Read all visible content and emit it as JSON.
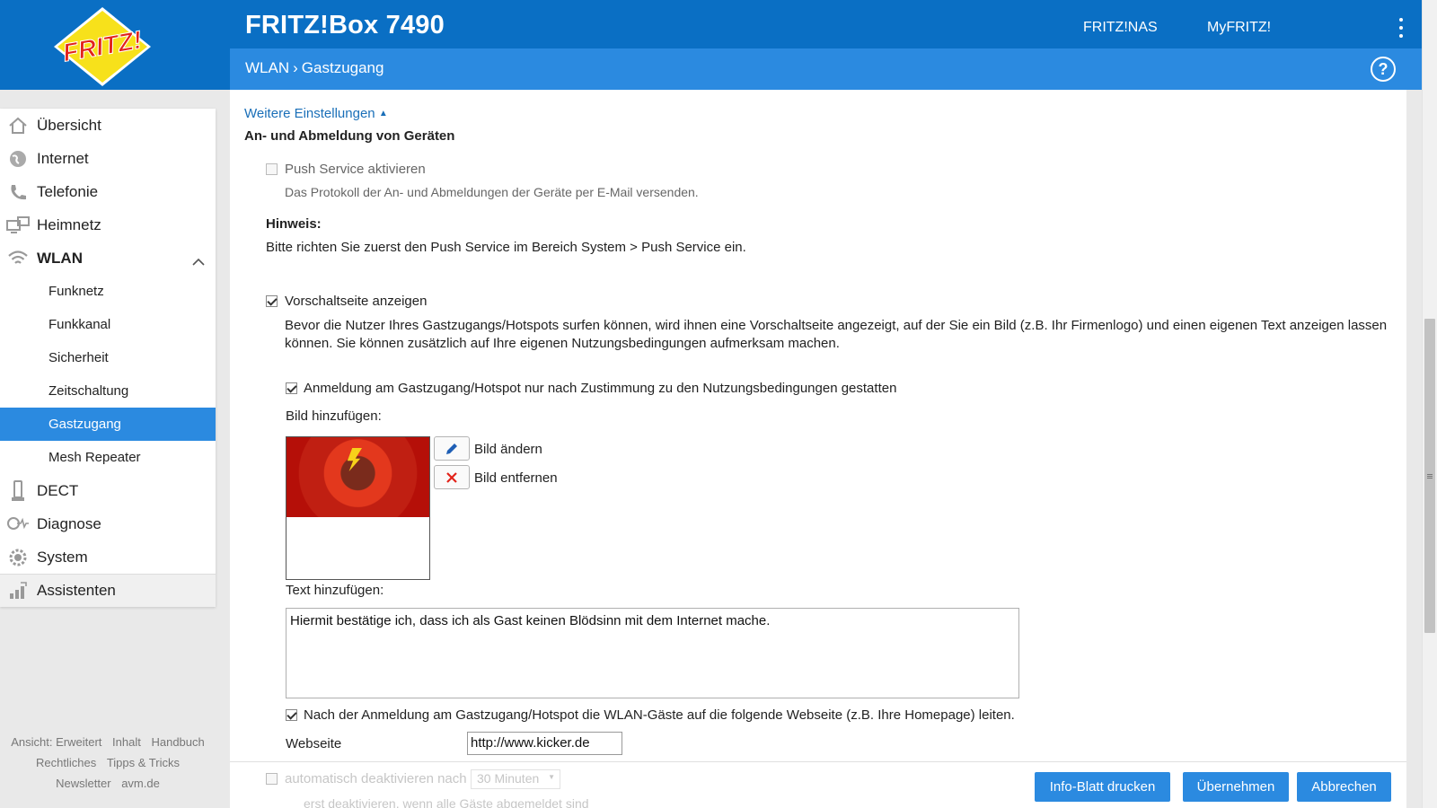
{
  "header": {
    "logo_text": "FRITZ!",
    "title": "FRITZ!Box 7490",
    "links": [
      "FRITZ!NAS",
      "MyFRITZ!"
    ],
    "breadcrumb": [
      "WLAN",
      "Gastzugang"
    ],
    "help_glyph": "?"
  },
  "sidebar": {
    "items": [
      {
        "label": "Übersicht",
        "icon": "home-icon"
      },
      {
        "label": "Internet",
        "icon": "globe-icon"
      },
      {
        "label": "Telefonie",
        "icon": "phone-icon"
      },
      {
        "label": "Heimnetz",
        "icon": "network-icon"
      },
      {
        "label": "WLAN",
        "icon": "wifi-icon"
      }
    ],
    "wlan_sub": [
      "Funknetz",
      "Funkkanal",
      "Sicherheit",
      "Zeitschaltung",
      "Gastzugang",
      "Mesh Repeater"
    ],
    "items_after": [
      {
        "label": "DECT",
        "icon": "dect-icon"
      },
      {
        "label": "Diagnose",
        "icon": "diagnose-icon"
      },
      {
        "label": "System",
        "icon": "system-icon"
      },
      {
        "label": "Assistenten",
        "icon": "wizard-icon"
      }
    ]
  },
  "footer": {
    "row1": [
      "Ansicht: Erweitert",
      "Inhalt",
      "Handbuch"
    ],
    "row2": [
      "Rechtliches",
      "Tipps & Tricks"
    ],
    "row3": [
      "Newsletter",
      "avm.de"
    ]
  },
  "content": {
    "more_settings": "Weitere Einstellungen",
    "section_title": "An- und Abmeldung von Geräten",
    "push_label": "Push Service aktivieren",
    "push_desc": "Das Protokoll der An- und Abmeldungen der Geräte per E-Mail versenden.",
    "hint_title": "Hinweis:",
    "hint_text": "Bitte richten Sie zuerst den Push Service im Bereich System > Push Service ein.",
    "splash_label": "Vorschaltseite anzeigen",
    "splash_desc1": "Bevor die Nutzer Ihres Gastzugangs/Hotspots surfen können, wird ihnen eine Vorschaltseite angezeigt, auf der Sie ein Bild (z.B. Ihr Firmenlogo) und einen eigenen Text anzeigen lassen",
    "splash_desc2": "können. Sie können zusätzlich auf Ihre eigenen Nutzungsbedingungen aufmerksam machen.",
    "terms_label": "Anmeldung am Gastzugang/Hotspot nur nach Zustimmung zu den Nutzungsbedingungen gestatten",
    "image_label": "Bild hinzufügen:",
    "change_image": "Bild ändern",
    "remove_image": "Bild entfernen",
    "text_label": "Text hinzufügen:",
    "text_value": "Hiermit bestätige ich, dass ich als Gast keinen Blödsinn mit dem Internet mache.",
    "redirect_label": "Nach der Anmeldung am Gastzugang/Hotspot die WLAN-Gäste auf die folgende Webseite (z.B. Ihre Homepage) leiten.",
    "website_label": "Webseite",
    "website_value": "http://www.kicker.de",
    "auto_deactivate": "automatisch deaktivieren nach",
    "auto_value": "30 Minuten",
    "auto_sub": "erst deaktivieren, wenn alle Gäste abgemeldet sind"
  },
  "buttons": {
    "print": "Info-Blatt drucken",
    "apply": "Übernehmen",
    "cancel": "Abbrechen"
  },
  "colors": {
    "header_blue": "#0a6fc4",
    "accent_blue": "#2b8ae0",
    "link_blue": "#1a6fb8"
  }
}
